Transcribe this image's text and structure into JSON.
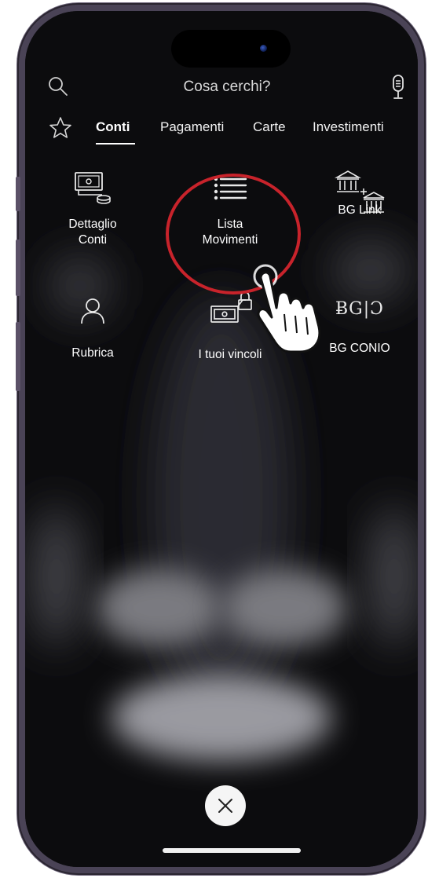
{
  "search": {
    "placeholder": "Cosa cerchi?",
    "left_icon": "search-icon",
    "right_icon": "microphone-icon"
  },
  "tabs": [
    {
      "label": "Conti",
      "active": true
    },
    {
      "label": "Pagamenti",
      "active": false
    },
    {
      "label": "Carte",
      "active": false
    },
    {
      "label": "Investimenti",
      "active": false
    }
  ],
  "favorites_icon": "star-icon",
  "tiles": [
    {
      "label_line1": "Dettaglio",
      "label_line2": "Conti",
      "icon": "cash-coins-icon"
    },
    {
      "label_line1": "Lista",
      "label_line2": "Movimenti",
      "icon": "list-icon"
    },
    {
      "label_line1": "BG Link",
      "label_line2": "",
      "icon": "bank-transfer-icon"
    },
    {
      "label_line1": "Rubrica",
      "label_line2": "",
      "icon": "person-icon"
    },
    {
      "label_line1": "I tuoi vincoli",
      "label_line2": "",
      "icon": "locked-cash-icon"
    },
    {
      "label_line1": "BG CONIO",
      "label_line2": "",
      "icon": "bg-conio-logo"
    }
  ],
  "bg_conio_logo_text": "ɃG|Ɔ",
  "colors": {
    "background": "#0c0c0e",
    "text": "#ffffff",
    "highlight": "#c8232b"
  },
  "close_icon": "close-icon"
}
